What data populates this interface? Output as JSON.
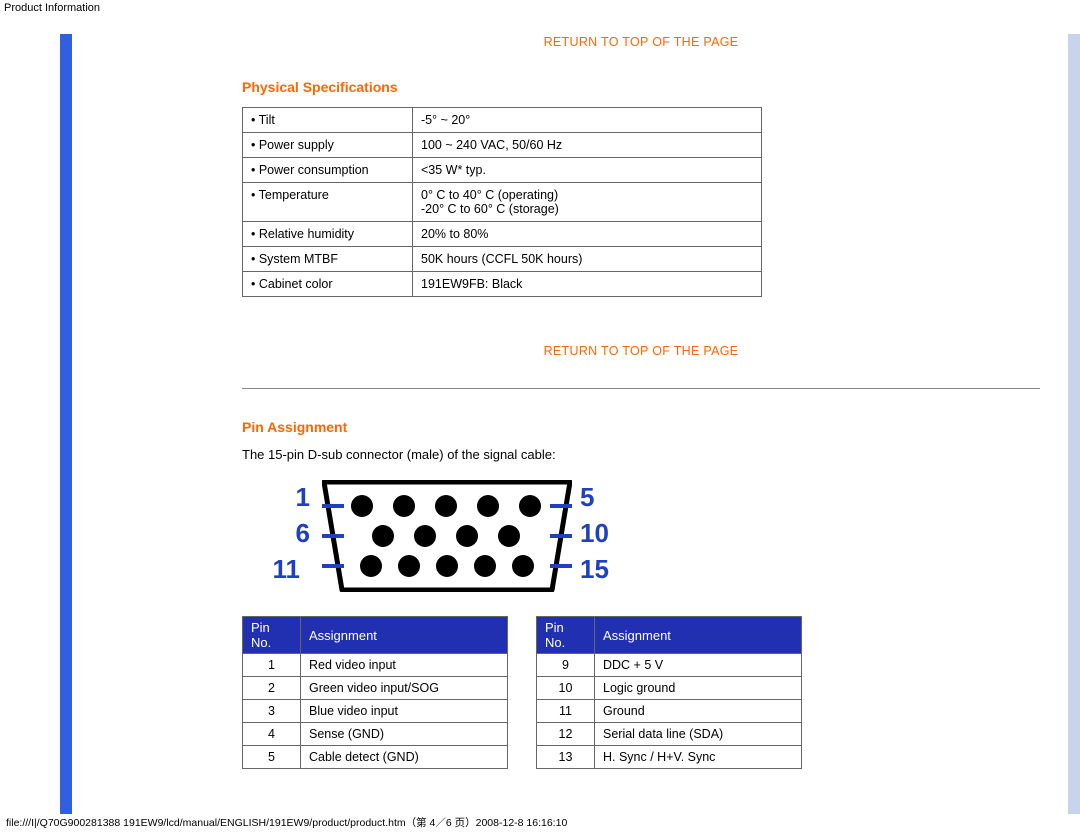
{
  "header": {
    "title": "Product Information"
  },
  "links": {
    "return_top": "RETURN TO TOP OF THE PAGE"
  },
  "sections": {
    "phys": {
      "title": "Physical Specifications",
      "rows": [
        {
          "label": "• Tilt",
          "value": "-5° ~ 20°"
        },
        {
          "label": "• Power supply",
          "value": "100 ~ 240 VAC, 50/60 Hz"
        },
        {
          "label": "• Power consumption",
          "value": "<35 W* typ."
        },
        {
          "label": "• Temperature",
          "value": "0° C to 40° C (operating)\n-20° C to 60° C (storage)"
        },
        {
          "label": "• Relative humidity",
          "value": "20% to 80%"
        },
        {
          "label": "• System MTBF",
          "value": "50K hours (CCFL 50K hours)"
        },
        {
          "label": "• Cabinet color",
          "value": "191EW9FB: Black"
        }
      ]
    },
    "pin": {
      "title": "Pin Assignment",
      "desc": "The 15-pin D-sub connector (male) of the signal cable:",
      "diagram_labels": {
        "l1": "1",
        "l2": "6",
        "l3": "11",
        "r1": "5",
        "r2": "10",
        "r3": "15"
      },
      "headers": {
        "pin": "Pin No.",
        "assign": "Assignment"
      },
      "left_rows": [
        {
          "n": "1",
          "a": "Red video input"
        },
        {
          "n": "2",
          "a": "Green video input/SOG"
        },
        {
          "n": "3",
          "a": "Blue video input"
        },
        {
          "n": "4",
          "a": "Sense (GND)"
        },
        {
          "n": "5",
          "a": "Cable detect (GND)"
        }
      ],
      "right_rows": [
        {
          "n": "9",
          "a": "DDC + 5 V"
        },
        {
          "n": "10",
          "a": "Logic ground"
        },
        {
          "n": "11",
          "a": "Ground"
        },
        {
          "n": "12",
          "a": "Serial data line (SDA)"
        },
        {
          "n": "13",
          "a": "H. Sync / H+V. Sync"
        }
      ]
    }
  },
  "footer": {
    "path": "file:///I|/Q70G900281388 191EW9/lcd/manual/ENGLISH/191EW9/product/product.htm（第 4／6 页）2008-12-8 16:16:10"
  }
}
